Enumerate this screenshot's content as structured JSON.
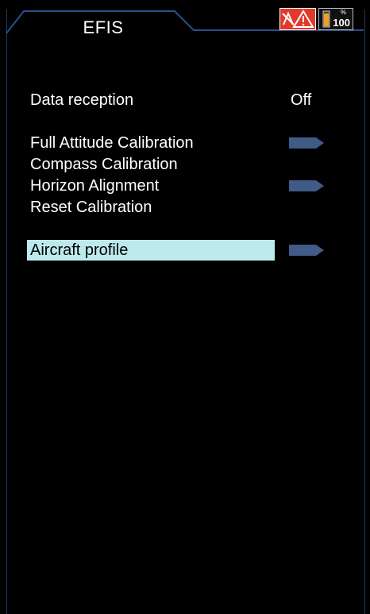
{
  "header": {
    "title": "EFIS",
    "battery_level": "100",
    "battery_unit": "%",
    "alert_icon": "warning-icon",
    "battery_icon": "battery-icon"
  },
  "menu": {
    "data_reception": {
      "label": "Data reception",
      "value": "Off"
    },
    "full_attitude": {
      "label": "Full Attitude Calibration"
    },
    "compass": {
      "label": "Compass Calibration"
    },
    "horizon": {
      "label": "Horizon Alignment"
    },
    "reset": {
      "label": "Reset Calibration"
    },
    "aircraft_profile": {
      "label": "Aircraft profile"
    }
  },
  "colors": {
    "selected_bg": "#bde9ec",
    "arrow": "#3f5b86",
    "alert": "#e23a2a"
  }
}
